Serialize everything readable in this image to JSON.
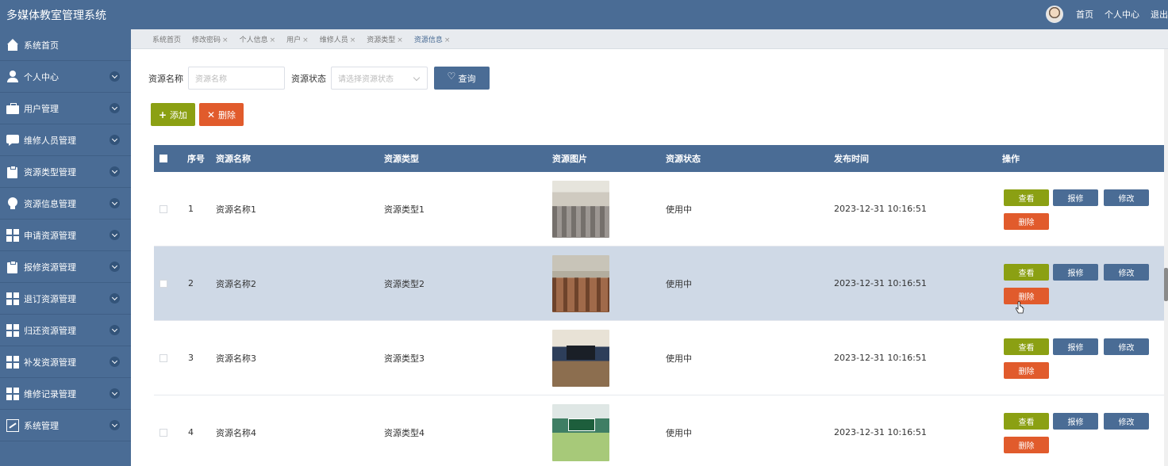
{
  "header": {
    "title": "多媒体教室管理系统",
    "nav": [
      "首页",
      "个人中心",
      "退出"
    ]
  },
  "sidebar": {
    "items": [
      {
        "label": "系统首页",
        "icon": "home-icon",
        "expandable": false
      },
      {
        "label": "个人中心",
        "icon": "user-icon",
        "expandable": true
      },
      {
        "label": "用户管理",
        "icon": "briefcase-icon",
        "expandable": true
      },
      {
        "label": "维修人员管理",
        "icon": "chat-icon",
        "expandable": true
      },
      {
        "label": "资源类型管理",
        "icon": "clipboard-check-icon",
        "expandable": true
      },
      {
        "label": "资源信息管理",
        "icon": "bulb-icon",
        "expandable": true
      },
      {
        "label": "申请资源管理",
        "icon": "grid-icon",
        "expandable": true
      },
      {
        "label": "报修资源管理",
        "icon": "clipboard-icon",
        "expandable": true
      },
      {
        "label": "退订资源管理",
        "icon": "grid-icon",
        "expandable": true
      },
      {
        "label": "归还资源管理",
        "icon": "grid-icon",
        "expandable": true
      },
      {
        "label": "补发资源管理",
        "icon": "grid-icon",
        "expandable": true
      },
      {
        "label": "维修记录管理",
        "icon": "grid-icon",
        "expandable": true
      },
      {
        "label": "系统管理",
        "icon": "chart-icon",
        "expandable": true
      }
    ]
  },
  "tabs": [
    {
      "label": "系统首页",
      "closable": false,
      "active": false
    },
    {
      "label": "修改密码",
      "closable": true,
      "active": false
    },
    {
      "label": "个人信息",
      "closable": true,
      "active": false
    },
    {
      "label": "用户",
      "closable": true,
      "active": false
    },
    {
      "label": "维修人员",
      "closable": true,
      "active": false
    },
    {
      "label": "资源类型",
      "closable": true,
      "active": false
    },
    {
      "label": "资源信息",
      "closable": true,
      "active": true
    }
  ],
  "tab_close": "×",
  "search": {
    "name_label": "资源名称",
    "name_placeholder": "资源名称",
    "status_label": "资源状态",
    "status_placeholder": "请选择资源状态",
    "query_label": "查询"
  },
  "actions": {
    "add_label": "添加",
    "add_symbol": "+",
    "delete_label": "删除",
    "delete_symbol": "✕"
  },
  "table": {
    "columns": [
      "序号",
      "资源名称",
      "资源类型",
      "资源图片",
      "资源状态",
      "发布时间",
      "操作"
    ],
    "rows": [
      {
        "no": "1",
        "name": "资源名称1",
        "type": "资源类型1",
        "status": "使用中",
        "time": "2023-12-31 10:16:51",
        "highlighted": false
      },
      {
        "no": "2",
        "name": "资源名称2",
        "type": "资源类型2",
        "status": "使用中",
        "time": "2023-12-31 10:16:51",
        "highlighted": true
      },
      {
        "no": "3",
        "name": "资源名称3",
        "type": "资源类型3",
        "status": "使用中",
        "time": "2023-12-31 10:16:51",
        "highlighted": false
      },
      {
        "no": "4",
        "name": "资源名称4",
        "type": "资源类型4",
        "status": "使用中",
        "time": "2023-12-31 10:16:51",
        "highlighted": false
      }
    ],
    "row_buttons": {
      "view": "查看",
      "repair": "报修",
      "edit": "修改",
      "delete": "删除"
    }
  },
  "colors": {
    "primary": "#4a6c95",
    "success": "#8ba013",
    "danger": "#e15b2c",
    "row_highlight": "#cfd9e6"
  }
}
